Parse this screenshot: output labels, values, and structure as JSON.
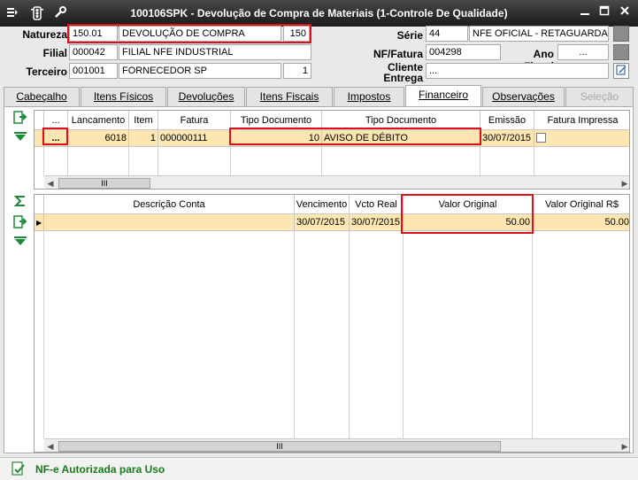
{
  "window": {
    "title": "100106SPK - Devolução de Compra de Materiais (1-Controle De Qualidade)",
    "icons": [
      "menu-icon",
      "traffic-light-icon",
      "wrench-icon"
    ],
    "buttons": [
      "minimize",
      "maximize",
      "close"
    ]
  },
  "header": {
    "natureza": {
      "label": "Natureza",
      "code": "150.01",
      "desc": "DEVOLUÇÃO DE COMPRA",
      "num": "150"
    },
    "filial": {
      "label": "Filial",
      "code": "000042",
      "desc": "FILIAL NFE INDUSTRIAL"
    },
    "terceiro": {
      "label": "Terceiro",
      "code": "001001",
      "desc": "FORNECEDOR SP",
      "num": "1"
    },
    "serie": {
      "label": "Série",
      "code": "44",
      "desc": "NFE OFICIAL - RETAGUARDA"
    },
    "nf_fatura": {
      "label": "NF/Fatura",
      "value": "004298"
    },
    "ano_fiscal": {
      "label": "Ano Fiscal",
      "value": "..."
    },
    "cliente_entrega": {
      "label": "Cliente\nEntrega",
      "value": "..."
    }
  },
  "tabs": [
    {
      "label": "Cabeçalho"
    },
    {
      "label": "Itens Físicos"
    },
    {
      "label": "Devoluções"
    },
    {
      "label": "Itens Fiscais"
    },
    {
      "label": "Impostos"
    },
    {
      "label": "Financeiro",
      "active": true
    },
    {
      "label": "Observações"
    },
    {
      "label": "Seleção",
      "disabled": true
    }
  ],
  "top_grid": {
    "headers": [
      "...",
      "Lancamento",
      "Item",
      "Fatura",
      "Tipo Documento",
      "Tipo Documento",
      "Emissão",
      "Fatura Impressa"
    ],
    "rows": [
      {
        "dots": "...",
        "lancamento": "6018",
        "item": "1",
        "fatura": "000000111",
        "tipo_num": "10",
        "tipo_desc": "AVISO DE DÉBITO",
        "emissao": "30/07/2015",
        "impressa": false
      }
    ],
    "scroll_thumb": "III"
  },
  "bottom_grid": {
    "headers": [
      "Descrição Conta",
      "Vencimento",
      "Vcto Real",
      "Valor Original",
      "Valor Original R$"
    ],
    "rows": [
      {
        "descricao": "",
        "vencimento": "30/07/2015",
        "vcto_real": "30/07/2015",
        "valor_original": "50.00",
        "valor_original_rs": "50.00"
      }
    ],
    "scroll_thumb": "III"
  },
  "side_icons": {
    "top": [
      "export-icon",
      "down-arrow-icon"
    ],
    "bottom": [
      "sigma-icon",
      "export-icon",
      "down-arrow-icon"
    ]
  },
  "status": {
    "text": "NF-e Autorizada para Uso"
  }
}
